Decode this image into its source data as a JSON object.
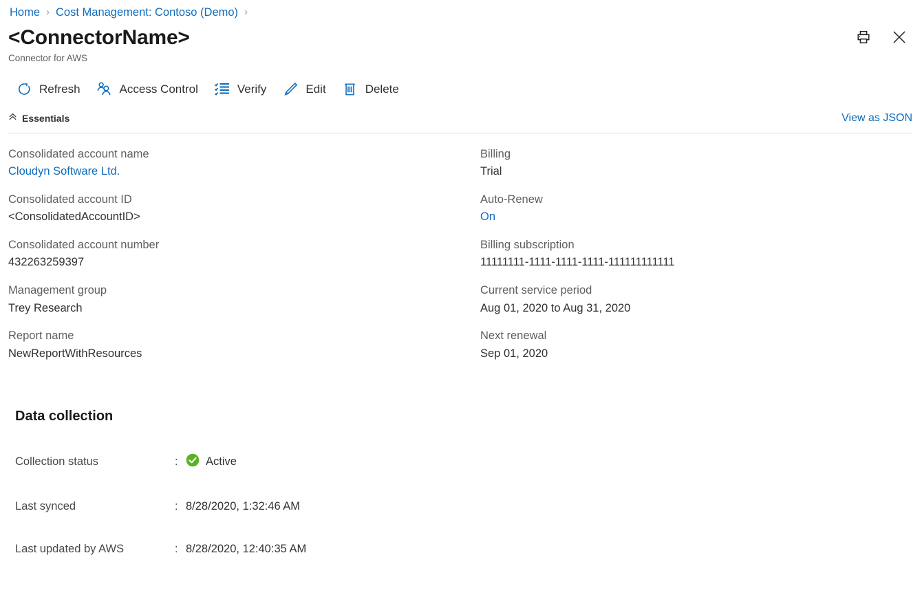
{
  "breadcrumb": {
    "items": [
      {
        "label": "Home"
      },
      {
        "label": "Cost Management: Contoso (Demo)"
      }
    ],
    "separator": "›"
  },
  "header": {
    "title": "<ConnectorName>",
    "subtitle": "Connector for AWS",
    "print_icon": "print-icon",
    "close_icon": "close-icon"
  },
  "commandbar": {
    "items": [
      {
        "label": "Refresh",
        "icon": "refresh-icon"
      },
      {
        "label": "Access Control",
        "icon": "people-icon"
      },
      {
        "label": "Verify",
        "icon": "checklist-icon"
      },
      {
        "label": "Edit",
        "icon": "pencil-icon"
      },
      {
        "label": "Delete",
        "icon": "trash-icon"
      }
    ]
  },
  "essentials": {
    "title": "Essentials",
    "collapse_icon": "chevron-double-up-icon",
    "view_as_json": "View as JSON",
    "left_column": [
      {
        "label": "Consolidated account name",
        "value": "Cloudyn Software Ltd.",
        "is_link": true
      },
      {
        "label": "Consolidated account ID",
        "value": "<ConsolidatedAccountID>",
        "is_link": false
      },
      {
        "label": "Consolidated account number",
        "value": "432263259397",
        "is_link": false
      },
      {
        "label": "Management group",
        "value": "Trey Research",
        "is_link": false
      },
      {
        "label": "Report name",
        "value": "NewReportWithResources",
        "is_link": false
      }
    ],
    "right_column": [
      {
        "label": "Billing",
        "value": "Trial",
        "is_link": false
      },
      {
        "label": "Auto-Renew",
        "value": "On",
        "is_link": true
      },
      {
        "label": "Billing subscription",
        "value": "11111111-1111-1111-1111-111111111111",
        "is_link": false
      },
      {
        "label": "Current service period",
        "value": "Aug 01, 2020 to Aug 31, 2020",
        "is_link": false
      },
      {
        "label": "Next renewal",
        "value": "Sep 01, 2020",
        "is_link": false
      }
    ]
  },
  "data_collection": {
    "title": "Data collection",
    "colon": ":",
    "rows": [
      {
        "label": "Collection status",
        "value": "Active",
        "icon": "success-check-icon"
      },
      {
        "label": "Last synced",
        "value": "8/28/2020, 1:32:46 AM",
        "icon": ""
      },
      {
        "label": "Last updated by AWS",
        "value": "8/28/2020, 12:40:35 AM",
        "icon": ""
      }
    ]
  },
  "colors": {
    "link": "#0f6cbd",
    "text": "#323130",
    "muted": "#605e5c",
    "success_green": "#5cb025",
    "divider": "#e1dfdd"
  }
}
